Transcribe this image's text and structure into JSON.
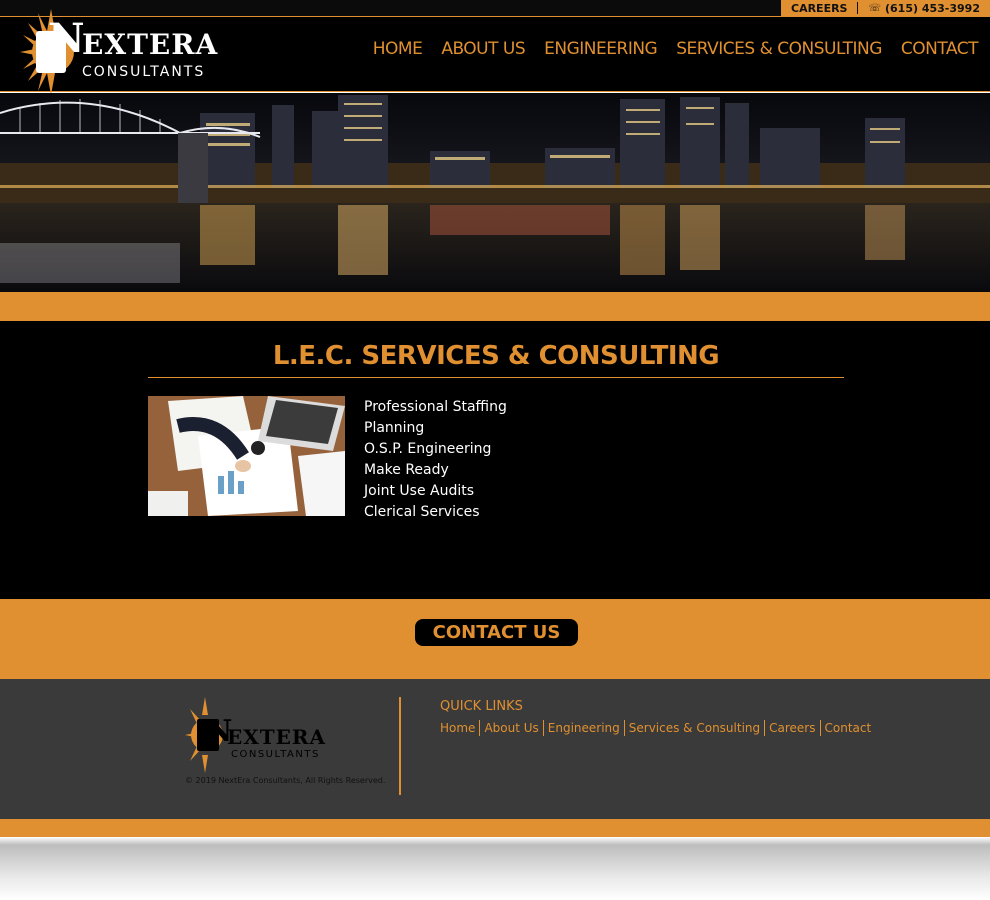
{
  "topbar": {
    "careers": "CAREERS",
    "phone": "(615) 453-3992",
    "phone_icon": "phone-icon"
  },
  "logo": {
    "brand_first": "N",
    "brand_rest": "EXTERA",
    "brand_sub": "CONSULTANTS"
  },
  "nav": {
    "items": [
      "HOME",
      "ABOUT US",
      "ENGINEERING",
      "SERVICES & CONSULTING",
      "CONTACT"
    ]
  },
  "main": {
    "title": "L.E.C. SERVICES & CONSULTING",
    "services": [
      "Professional Staffing",
      "Planning",
      "O.S.P. Engineering",
      "Make Ready",
      "Joint Use Audits",
      "Clerical Services"
    ]
  },
  "cta": {
    "label": "CONTACT US"
  },
  "footer": {
    "copyright": "© 2019 NextEra Consultants, All Rights Reserved.",
    "quick_links_title": "QUICK LINKS",
    "quick_links": [
      "Home",
      "About Us",
      "Engineering",
      "Services & Consulting",
      "Careers",
      "Contact"
    ]
  },
  "colors": {
    "accent": "#e09030",
    "background": "#000000",
    "footer": "#3a3a3a"
  }
}
